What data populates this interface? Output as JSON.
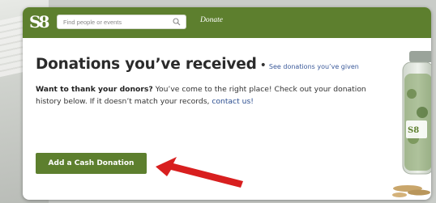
{
  "header": {
    "logo_text": "S8",
    "search_placeholder": "Find people or events",
    "nav_donate": "Donate"
  },
  "main": {
    "title": "Donations you’ve received",
    "separator": "•",
    "see_given_link": "See donations you’ve given",
    "intro_bold": "Want to thank your donors?",
    "intro_text": "You’ve come to the right place! Check out your donation history below. If it doesn’t match your records,",
    "contact_link": "contact us!",
    "add_cash_button": "Add a Cash Donation"
  },
  "colors": {
    "brand_green": "#5d7f2e",
    "link_blue": "#2a4d8f",
    "arrow_red": "#d81f1f"
  },
  "icons": [
    "logo-icon",
    "search-icon",
    "red-arrow-icon",
    "donation-jar-image"
  ]
}
